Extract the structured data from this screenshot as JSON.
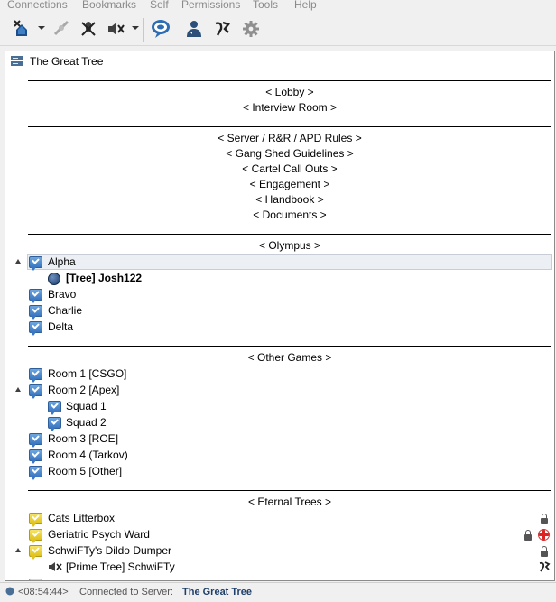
{
  "menu": [
    "Connections",
    "Bookmarks",
    "Self",
    "Permissions",
    "Tools",
    "Help"
  ],
  "toolbar": {
    "icons": [
      "disconnect-icon",
      "connect-icon",
      "mute-microphone-icon",
      "mute-speakers-icon",
      "chat-icon",
      "contacts-icon",
      "whisper-icon",
      "settings-icon"
    ]
  },
  "tree": {
    "server": "The Great Tree",
    "spacers": {
      "lobby": "Lobby",
      "interview": "Interview Room",
      "server_rules": "Server / R&R / APD Rules",
      "gang_shed": "Gang Shed Guidelines",
      "cartel": "Cartel Call Outs",
      "engagement": "Engagement",
      "handbook": "Handbook",
      "documents": "Documents",
      "olympus": "Olympus",
      "other_games": "Other Games",
      "eternal_trees": "Eternal Trees"
    },
    "olympus_channels": [
      {
        "label": "Alpha"
      },
      {
        "label": "Bravo"
      },
      {
        "label": "Charlie"
      },
      {
        "label": "Delta"
      }
    ],
    "alpha_user": "[Tree] Josh122",
    "games_channels": [
      {
        "label": "Room 1 [CSGO]"
      },
      {
        "label": "Room 2 [Apex]"
      },
      {
        "label": "Squad 1"
      },
      {
        "label": "Squad 2"
      },
      {
        "label": "Room 3 [ROE]"
      },
      {
        "label": "Room 4 (Tarkov)"
      },
      {
        "label": "Room 5 [Other]"
      }
    ],
    "eternal_channels": [
      {
        "label": "Cats Litterbox"
      },
      {
        "label": "Geriatric Psych Ward"
      },
      {
        "label": "SchwiFTy's Dildo Dumper"
      }
    ],
    "dumper_user": "[Prime Tree] SchwiFTy"
  },
  "status": {
    "time": "<08:54:44>",
    "message": "Connected to Server:",
    "server": "The Great Tree"
  },
  "colors": {
    "channel_blue": "#3a77c2",
    "channel_yellow": "#e0c21a",
    "selection": "#eceff4"
  }
}
